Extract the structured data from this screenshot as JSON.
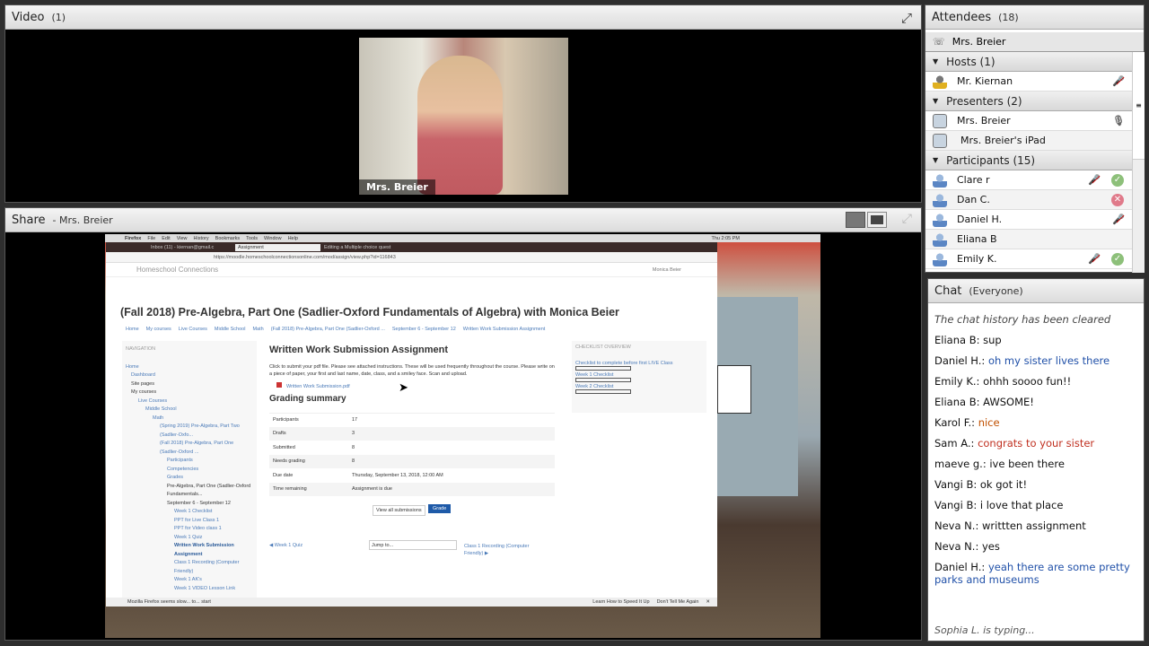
{
  "video": {
    "title": "Video",
    "count": "(1)",
    "name_tag": "Mrs. Breier"
  },
  "share": {
    "title": "Share",
    "presenter": "- Mrs. Breier"
  },
  "attendees": {
    "title": "Attendees",
    "count": "(18)",
    "me": "Mrs. Breier",
    "groups": [
      {
        "label": "Hosts (1)",
        "members": [
          {
            "name": "Mr. Kiernan",
            "role": "host",
            "mic_muted": true
          }
        ]
      },
      {
        "label": "Presenters (2)",
        "members": [
          {
            "name": "Mrs. Breier",
            "role": "presenter",
            "mic_active": true
          },
          {
            "name": "Mrs. Breier's iPad",
            "role": "presenter-device"
          }
        ]
      },
      {
        "label": "Participants (15)",
        "members": [
          {
            "name": "Clare r",
            "mic_muted": true,
            "status": "agree"
          },
          {
            "name": "Dan C.",
            "status": "disagree"
          },
          {
            "name": "Daniel H.",
            "mic_muted": true
          },
          {
            "name": "Eliana B",
            "role": "device"
          },
          {
            "name": "Emily K.",
            "mic_muted": true,
            "status": "agree"
          }
        ]
      }
    ]
  },
  "chat": {
    "title": "Chat",
    "scope": "(Everyone)",
    "cleared": "The chat history has been cleared",
    "typing": "Sophia L. is typing...",
    "messages": [
      {
        "from": "Eliana B:",
        "text": "sup",
        "color": "#111111"
      },
      {
        "from": "Daniel H.:",
        "text": "oh my sister lives there",
        "color": "#2050a8"
      },
      {
        "from": "Emily K.:",
        "text": "ohhh soooo fun!!",
        "color": "#111111"
      },
      {
        "from": "Eliana B:",
        "text": "AWSOME!",
        "color": "#111111"
      },
      {
        "from": "Karol F.:",
        "text": "nice",
        "color": "#c05000"
      },
      {
        "from": "Sam A.:",
        "text": "congrats to your sister",
        "color": "#c03020"
      },
      {
        "from": "maeve g.:",
        "text": "ive been there",
        "color": "#111111"
      },
      {
        "from": "Vangi B:",
        "text": "ok got it!",
        "color": "#111111"
      },
      {
        "from": "Vangi B:",
        "text": "i love that place",
        "color": "#111111"
      },
      {
        "from": "Neva N.:",
        "text": "writtten assignment",
        "color": "#111111"
      },
      {
        "from": "Neva N.:",
        "text": "yes",
        "color": "#111111"
      },
      {
        "from": "Daniel H.:",
        "text": "yeah there are some pretty parks and museums",
        "color": "#2050a8"
      }
    ]
  },
  "screen": {
    "menu": [
      "Firefox",
      "File",
      "Edit",
      "View",
      "History",
      "Bookmarks",
      "Tools",
      "Window",
      "Help"
    ],
    "clock": "Thu 2:05 PM",
    "tabs": [
      "Inbox (11) - kiernan@gmail.c",
      "Assignment",
      "Editing a Multiple choice quest"
    ],
    "url": "https://moodle.homeschoolconnectionsonline.com/mod/assign/view.php?id=116843",
    "site": "Homeschool Connections",
    "user": "Monica Beier",
    "course_title": "(Fall 2018) Pre-Algebra, Part One (Sadlier-Oxford Fundamentals of Algebra) with Monica Beier",
    "breadcrumb": [
      "Home",
      "My courses",
      "Live Courses",
      "Middle School",
      "Math",
      "(Fall 2018) Pre-Algebra, Part One (Sadlier-Oxford ...",
      "September 6 - September 12",
      "Written Work Submission Assignment"
    ],
    "nav_title": "NAVIGATION",
    "nav": [
      "Home",
      "Dashboard",
      "Site pages",
      "My courses",
      "Live Courses",
      "Middle School",
      "Math",
      "(Spring 2019) Pre-Algebra, Part Two (Sadlier-Oxfo...",
      "(Fall 2018) Pre-Algebra, Part One (Sadlier-Oxford ...",
      "Participants",
      "Competencies",
      "Grades",
      "Pre-Algebra, Part One (Sadlier-Oxford Fundamentals...",
      "September 6 - September 12",
      "Week 1 Checklist",
      "PPT for Live Class 1",
      "PPT for Video class 1",
      "Week 1 Quiz",
      "Written Work Submission Assignment",
      "Class 1 Recording (Computer Friendly)",
      "Week 1 AK's",
      "Week 1 VIDEO Lesson Link"
    ],
    "assign_title": "Written Work Submission Assignment",
    "assign_desc": "Click to submit your pdf file. Please see attached instructions. These will be used frequently throughout the course. Please write on a piece of paper, your first and last name, date, class, and a smiley face. Scan and upload.",
    "attachment": "Written Work Submission.pdf",
    "grading_title": "Grading summary",
    "grading": [
      [
        "Participants",
        "17"
      ],
      [
        "Drafts",
        "3"
      ],
      [
        "Submitted",
        "8"
      ],
      [
        "Needs grading",
        "8"
      ],
      [
        "Due date",
        "Thursday, September 13, 2018, 12:00 AM"
      ],
      [
        "Time remaining",
        "Assignment is due"
      ]
    ],
    "view_all": "View all submissions",
    "grade": "Grade",
    "prev": "◀ Week 1 Quiz",
    "jump": "Jump to...",
    "next": "Class 1 Recording (Computer Friendly) ▶",
    "checklist_title": "CHECKLIST OVERVIEW",
    "checklists": [
      "Checklist to complete before first LIVE Class",
      "Week 1 Checklist",
      "Week 2 Checklist"
    ],
    "notice": "Mozilla Firefox seems slow... to... start",
    "notice_btn1": "Learn How to Speed It Up",
    "notice_btn2": "Don't Tell Me Again"
  }
}
